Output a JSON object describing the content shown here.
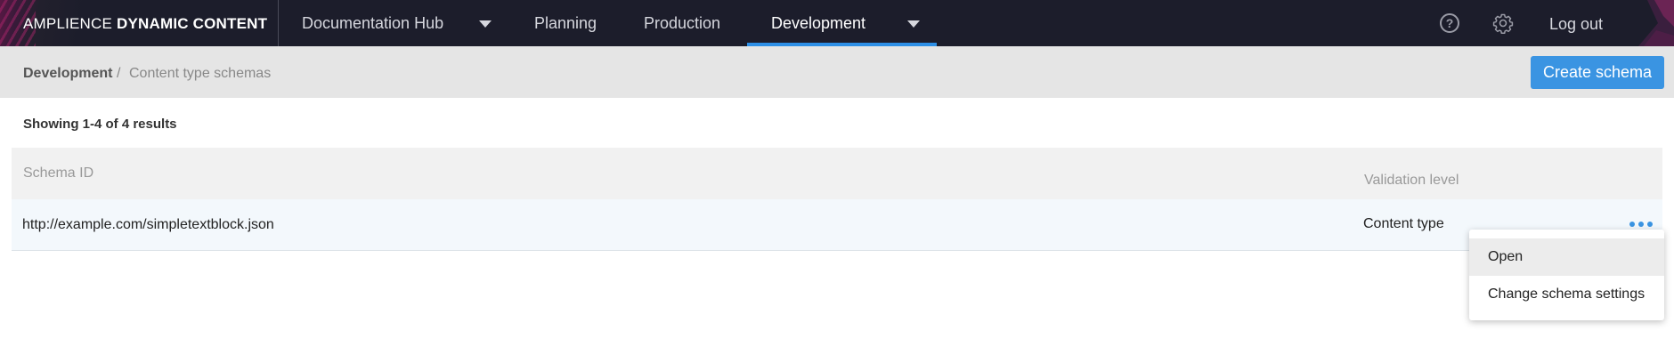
{
  "app": {
    "brand_light": "AMPLIENCE",
    "brand_bold": "DYNAMIC CONTENT"
  },
  "nav": {
    "hub_label": "Documentation Hub",
    "items": [
      {
        "label": "Planning"
      },
      {
        "label": "Production"
      },
      {
        "label": "Development",
        "active": true
      }
    ],
    "logout_label": "Log out",
    "help_symbol": "?"
  },
  "breadcrumb": {
    "root": "Development",
    "separator": "/",
    "page": "Content type schemas"
  },
  "toolbar": {
    "create_label": "Create schema"
  },
  "results_text": "Showing 1-4 of 4 results",
  "table": {
    "columns": [
      "Schema ID",
      "Validation level"
    ],
    "rows": [
      {
        "schema_id": "http://example.com/simpletextblock.json",
        "validation_level": "Content type"
      }
    ]
  },
  "row_menu": {
    "items": [
      "Open",
      "Change schema settings"
    ],
    "highlighted": "Open"
  },
  "colors": {
    "accent": "#3a94e2",
    "topbar_bg": "#1c1d2b",
    "subheader_bg": "#e5e5e5"
  },
  "icons": [
    "question-circle-icon",
    "gear-icon",
    "chevron-down-icon",
    "more-horizontal-icon"
  ]
}
